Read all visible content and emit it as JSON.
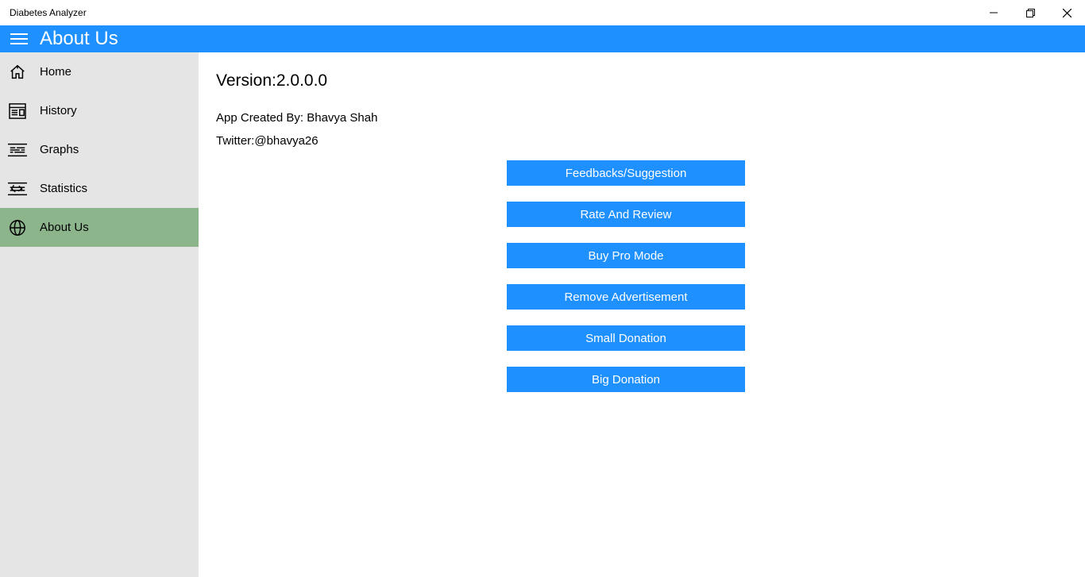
{
  "window": {
    "title": "Diabetes Analyzer"
  },
  "header": {
    "title": "About Us"
  },
  "sidebar": {
    "items": [
      {
        "label": "Home"
      },
      {
        "label": "History"
      },
      {
        "label": "Graphs"
      },
      {
        "label": "Statistics"
      },
      {
        "label": "About Us"
      }
    ]
  },
  "about": {
    "version": "Version:2.0.0.0",
    "creator": "App Created By: Bhavya Shah",
    "twitter": "Twitter:@bhavya26"
  },
  "buttons": {
    "feedback": "Feedbacks/Suggestion",
    "rate": "Rate And Review",
    "buy": "Buy Pro Mode",
    "remove_ads": "Remove Advertisement",
    "small_donation": "Small Donation",
    "big_donation": "Big Donation"
  }
}
